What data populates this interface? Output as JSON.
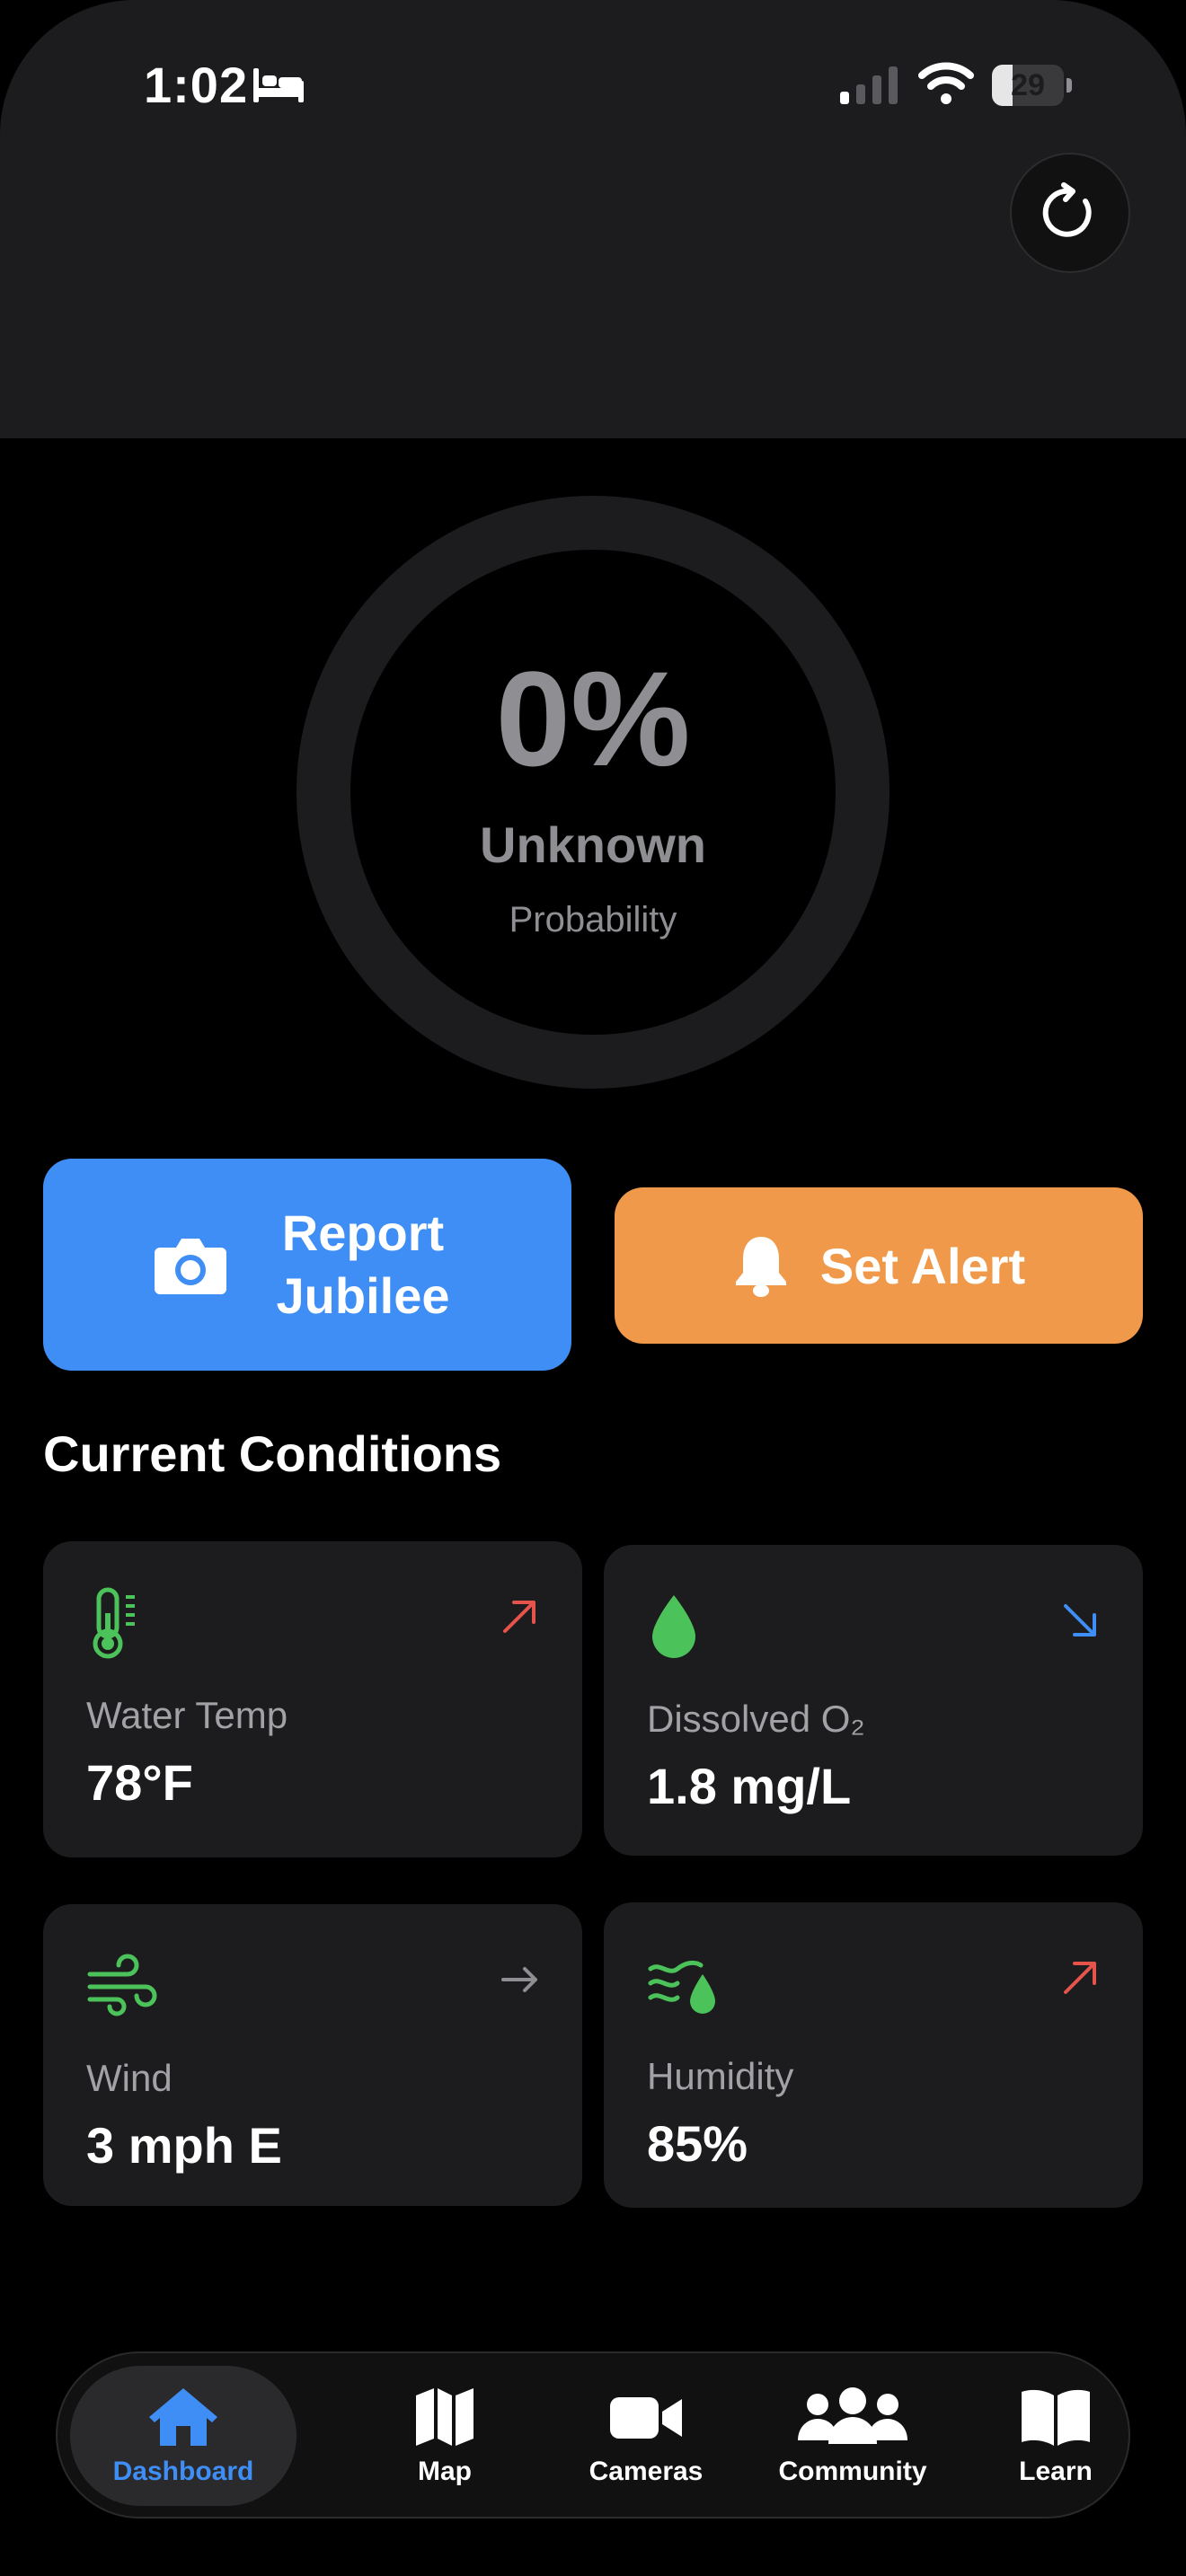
{
  "status_bar": {
    "time": "1:02",
    "battery": "29",
    "battery_level": 0.29
  },
  "gauge": {
    "value": "0%",
    "status": "Unknown",
    "label": "Probability",
    "progress": 0
  },
  "actions": {
    "report_label": "Report Jubilee",
    "alert_label": "Set Alert"
  },
  "conditions": {
    "title": "Current Conditions",
    "cards": [
      {
        "label": "Water Temp",
        "value": "78°F",
        "icon": "thermometer-icon",
        "trend": "up"
      },
      {
        "label": "Dissolved O₂",
        "value": "1.8 mg/L",
        "icon": "droplet-icon",
        "trend": "down"
      },
      {
        "label": "Wind",
        "value": "3 mph E",
        "icon": "wind-icon",
        "trend": "steady"
      },
      {
        "label": "Humidity",
        "value": "85%",
        "icon": "humidity-icon",
        "trend": "up"
      }
    ]
  },
  "tabs": [
    {
      "label": "Dashboard",
      "icon": "house-icon",
      "active": true
    },
    {
      "label": "Map",
      "icon": "map-icon",
      "active": false
    },
    {
      "label": "Cameras",
      "icon": "video-camera-icon",
      "active": false
    },
    {
      "label": "Community",
      "icon": "people-icon",
      "active": false
    },
    {
      "label": "Learn",
      "icon": "book-icon",
      "active": false
    }
  ],
  "colors": {
    "accent_blue": "#3f8ef5",
    "accent_orange": "#f0994a",
    "icon_green": "#4cc25a",
    "trend_up": "#e5534b",
    "trend_down": "#3f8ef5",
    "trend_steady": "#8e8e93"
  }
}
